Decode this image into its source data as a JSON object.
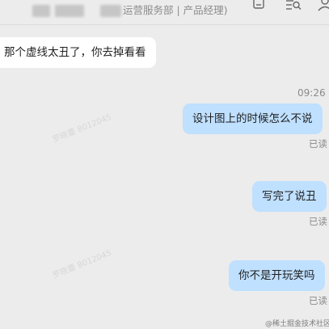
{
  "header": {
    "title": "运营服务部 | 产品经理)",
    "icons": [
      "notes-icon",
      "search-list-icon",
      "member-icon"
    ]
  },
  "messages": [
    {
      "direction": "incoming",
      "text": "那个虚线太丑了，你去掉看看"
    },
    {
      "direction": "outgoing",
      "text": "设计图上的时候怎么不说",
      "status": "已读"
    },
    {
      "direction": "outgoing",
      "text": "写完了说丑",
      "status": "已读"
    },
    {
      "direction": "outgoing",
      "text": "你不是开玩笑吗",
      "status": "已读"
    }
  ],
  "timestamp": "09:26",
  "footer_watermark": "@稀土掘金技术社区",
  "colors": {
    "background": "#ececec",
    "incoming_bubble": "#ffffff",
    "outgoing_bubble": "#bfe0ff",
    "meta_text": "#8a8a8a"
  }
}
